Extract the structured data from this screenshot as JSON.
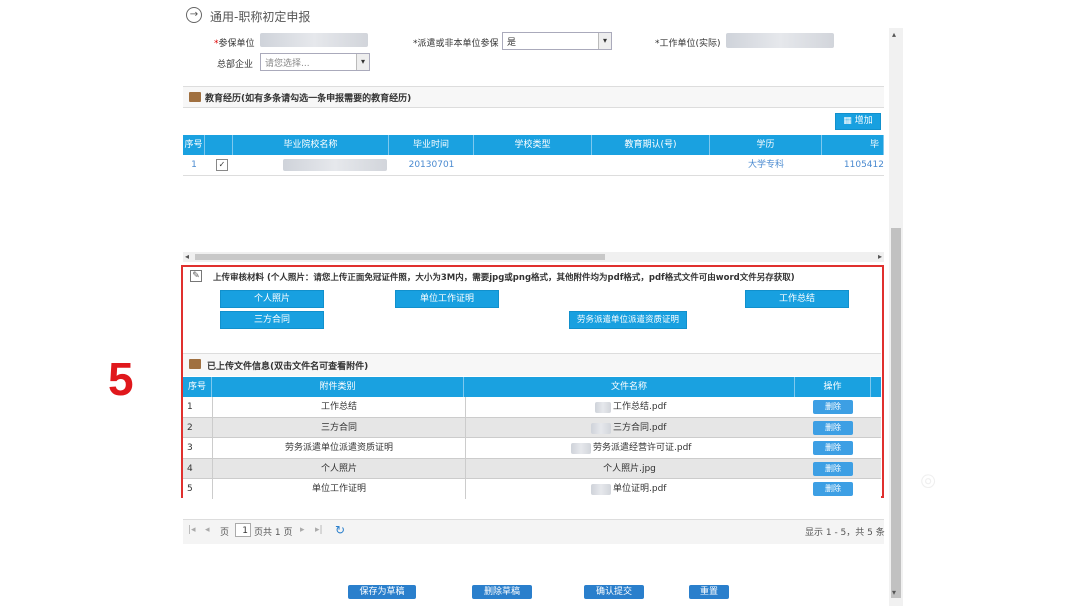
{
  "title": {
    "text": "通用-职称初定申报"
  },
  "form": {
    "label_unit": "*参保单位",
    "label_dispatch": "*派遣或非本单位参保",
    "dispatch_value": "是",
    "label_work_unit": "*工作单位(实际)",
    "label_hq": "总部企业",
    "hq_placeholder": "请您选择..."
  },
  "education": {
    "heading": "教育经历(如有多条请勾选一条申报需要的教育经历)",
    "add_button": "增加",
    "columns": [
      "序号",
      "",
      "毕业院校名称",
      "毕业时间",
      "学校类型",
      "教育期认(号)",
      "学历",
      "毕"
    ],
    "rows": [
      {
        "no": "1",
        "checked": "✓",
        "school": "",
        "grad_time": "20130701",
        "type": "",
        "edu_id": "",
        "degree": "大学专科",
        "extra": "1105412"
      }
    ]
  },
  "upload": {
    "heading": "上传审核材料 (个人照片：请您上传正面免冠证件照，大小为3M内，需要jpg或png格式，其他附件均为pdf格式，pdf格式文件可由word文件另存获取)",
    "buttons": {
      "personal_photo": "个人照片",
      "unit_cert": "单位工作证明",
      "work_summary": "工作总结",
      "contract": "三方合同",
      "dispatch_cert": "劳务派遣单位派遣资质证明"
    }
  },
  "uploaded": {
    "heading": "已上传文件信息(双击文件名可查看附件)",
    "columns": [
      "序号",
      "附件类别",
      "文件名称",
      "操作"
    ],
    "rows": [
      {
        "no": "1",
        "category": "工作总结",
        "file": "工作总结.pdf",
        "action": "删除"
      },
      {
        "no": "2",
        "category": "三方合同",
        "file": "三方合同.pdf",
        "action": "删除"
      },
      {
        "no": "3",
        "category": "劳务派遣单位派遣资质证明",
        "file": "劳务派遣经营许可证.pdf",
        "action": "删除"
      },
      {
        "no": "4",
        "category": "个人照片",
        "file": "个人照片.jpg",
        "action": "删除"
      },
      {
        "no": "5",
        "category": "单位工作证明",
        "file": "单位证明.pdf",
        "action": "删除"
      }
    ]
  },
  "pager": {
    "page_label": "页",
    "page_value": "1",
    "page_total": "页共 1 页",
    "summary": "显示 1 - 5，共 5 条"
  },
  "footer_buttons": {
    "save": "保存为草稿",
    "delete": "删除草稿",
    "submit": "确认提交",
    "reset": "重置"
  },
  "step_marker": "5",
  "colors": {
    "accent": "#1aa1e0",
    "highlight": "#e0302e",
    "marker": "#e0181c"
  }
}
